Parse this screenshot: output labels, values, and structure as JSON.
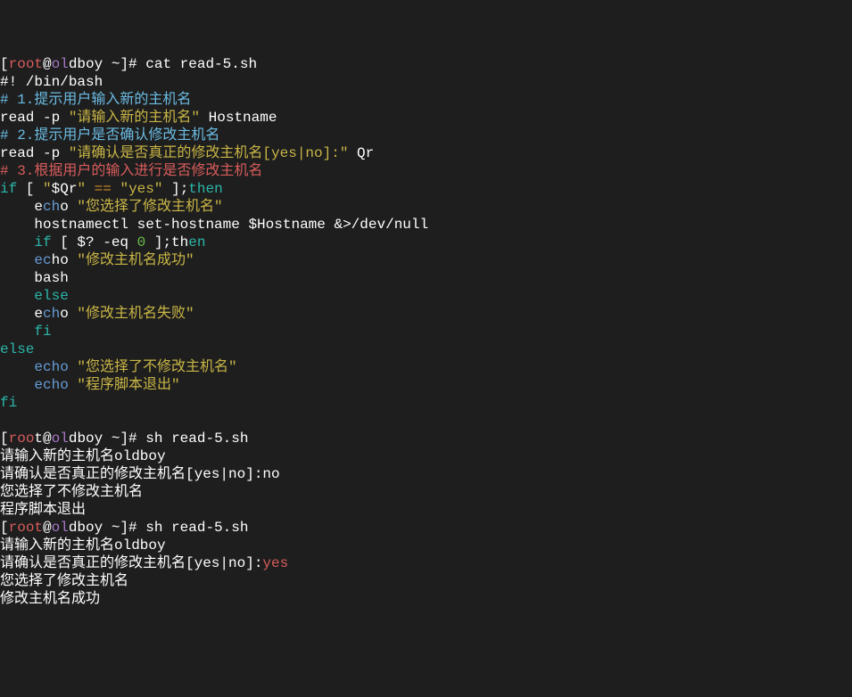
{
  "lines": [
    {
      "segments": [
        {
          "text": "[",
          "cls": "white"
        },
        {
          "text": "root",
          "cls": "red"
        },
        {
          "text": "@",
          "cls": "white"
        },
        {
          "text": "ol",
          "cls": "purple"
        },
        {
          "text": "dboy ~]# cat read-5.sh",
          "cls": "white"
        }
      ]
    },
    {
      "segments": [
        {
          "text": "#! /bin/bash",
          "cls": "white"
        }
      ]
    },
    {
      "segments": [
        {
          "text": "# 1.提示用户输入新的主机名",
          "cls": "cyan"
        }
      ]
    },
    {
      "segments": [
        {
          "text": "read -p ",
          "cls": "white"
        },
        {
          "text": "\"请输入新的主机名\"",
          "cls": "yellow"
        },
        {
          "text": " Hostname",
          "cls": "white"
        }
      ]
    },
    {
      "segments": [
        {
          "text": "# 2.提示用户是否确认修改主机名",
          "cls": "cyan"
        }
      ]
    },
    {
      "segments": [
        {
          "text": "read -p ",
          "cls": "white"
        },
        {
          "text": "\"请确认是否真正的修改主机名[yes|no]:\"",
          "cls": "yellow"
        },
        {
          "text": " Qr",
          "cls": "white"
        }
      ]
    },
    {
      "segments": [
        {
          "text": "# 3.根据用户的输入进行是否修改主机名",
          "cls": "red"
        }
      ]
    },
    {
      "segments": [
        {
          "text": "if",
          "cls": "teal"
        },
        {
          "text": " [ ",
          "cls": "white"
        },
        {
          "text": "\"",
          "cls": "yellow"
        },
        {
          "text": "$Qr",
          "cls": "white"
        },
        {
          "text": "\"",
          "cls": "yellow"
        },
        {
          "text": " ",
          "cls": "white"
        },
        {
          "text": "==",
          "cls": "orange"
        },
        {
          "text": " ",
          "cls": "white"
        },
        {
          "text": "\"yes\"",
          "cls": "yellow"
        },
        {
          "text": " ];",
          "cls": "white"
        },
        {
          "text": "then",
          "cls": "teal"
        }
      ]
    },
    {
      "segments": [
        {
          "text": "    e",
          "cls": "white"
        },
        {
          "text": "ch",
          "cls": "blue"
        },
        {
          "text": "o ",
          "cls": "white"
        },
        {
          "text": "\"您选择了修改主机名\"",
          "cls": "yellow"
        }
      ]
    },
    {
      "segments": [
        {
          "text": "    hostnamectl set-hostname ",
          "cls": "white"
        },
        {
          "text": "$Hostname",
          "cls": "white"
        },
        {
          "text": " &>/dev/null",
          "cls": "white"
        }
      ]
    },
    {
      "segments": [
        {
          "text": "    ",
          "cls": "white"
        },
        {
          "text": "if",
          "cls": "teal"
        },
        {
          "text": " [ ",
          "cls": "white"
        },
        {
          "text": "$?",
          "cls": "white"
        },
        {
          "text": " -eq ",
          "cls": "white"
        },
        {
          "text": "0",
          "cls": "green"
        },
        {
          "text": " ];th",
          "cls": "white"
        },
        {
          "text": "en",
          "cls": "teal"
        }
      ]
    },
    {
      "segments": [
        {
          "text": "    ",
          "cls": "white"
        },
        {
          "text": "ec",
          "cls": "blue"
        },
        {
          "text": "ho ",
          "cls": "white"
        },
        {
          "text": "\"修改主机名成功\"",
          "cls": "yellow"
        }
      ]
    },
    {
      "segments": [
        {
          "text": "    bash",
          "cls": "white"
        }
      ]
    },
    {
      "segments": [
        {
          "text": "    ",
          "cls": "white"
        },
        {
          "text": "else",
          "cls": "teal"
        }
      ]
    },
    {
      "segments": [
        {
          "text": "    e",
          "cls": "white"
        },
        {
          "text": "ch",
          "cls": "blue"
        },
        {
          "text": "o ",
          "cls": "white"
        },
        {
          "text": "\"修改主机名失败\"",
          "cls": "yellow"
        }
      ]
    },
    {
      "segments": [
        {
          "text": "    ",
          "cls": "white"
        },
        {
          "text": "fi",
          "cls": "teal"
        }
      ]
    },
    {
      "segments": [
        {
          "text": "else",
          "cls": "teal"
        }
      ]
    },
    {
      "segments": [
        {
          "text": "    ",
          "cls": "white"
        },
        {
          "text": "echo",
          "cls": "blue"
        },
        {
          "text": " ",
          "cls": "white"
        },
        {
          "text": "\"您选择了不修改主机名\"",
          "cls": "yellow"
        }
      ]
    },
    {
      "segments": [
        {
          "text": "    ",
          "cls": "white"
        },
        {
          "text": "echo",
          "cls": "blue"
        },
        {
          "text": " ",
          "cls": "white"
        },
        {
          "text": "\"程序脚本退出\"",
          "cls": "yellow"
        }
      ]
    },
    {
      "segments": [
        {
          "text": "fi",
          "cls": "teal"
        }
      ]
    },
    {
      "segments": [
        {
          "text": "",
          "cls": "white"
        }
      ]
    },
    {
      "segments": [
        {
          "text": "[",
          "cls": "white"
        },
        {
          "text": "roo",
          "cls": "red"
        },
        {
          "text": "t",
          "cls": "white"
        },
        {
          "text": "@",
          "cls": "white"
        },
        {
          "text": "ol",
          "cls": "purple"
        },
        {
          "text": "dboy ~]# sh read-5.sh",
          "cls": "white"
        }
      ]
    },
    {
      "segments": [
        {
          "text": "请输入新的主机名oldboy",
          "cls": "white"
        }
      ]
    },
    {
      "segments": [
        {
          "text": "请确认是否真正的修改主机名[yes|no]:no",
          "cls": "white"
        }
      ]
    },
    {
      "segments": [
        {
          "text": "您选择了不修改主机名",
          "cls": "white"
        }
      ]
    },
    {
      "segments": [
        {
          "text": "程序脚本退出",
          "cls": "white"
        }
      ]
    },
    {
      "segments": [
        {
          "text": "[",
          "cls": "white"
        },
        {
          "text": "root",
          "cls": "red"
        },
        {
          "text": "@",
          "cls": "white"
        },
        {
          "text": "ol",
          "cls": "purple"
        },
        {
          "text": "dboy ~]# sh read-5.sh",
          "cls": "white"
        }
      ]
    },
    {
      "segments": [
        {
          "text": "请输入新的主机名oldboy",
          "cls": "white"
        }
      ]
    },
    {
      "segments": [
        {
          "text": "请确认是否真正的修改主机名[yes|no]:",
          "cls": "white"
        },
        {
          "text": "yes",
          "cls": "red"
        }
      ]
    },
    {
      "segments": [
        {
          "text": "您选择了修改主机名",
          "cls": "white"
        }
      ]
    },
    {
      "segments": [
        {
          "text": "修改主机名成功",
          "cls": "white"
        }
      ]
    }
  ]
}
